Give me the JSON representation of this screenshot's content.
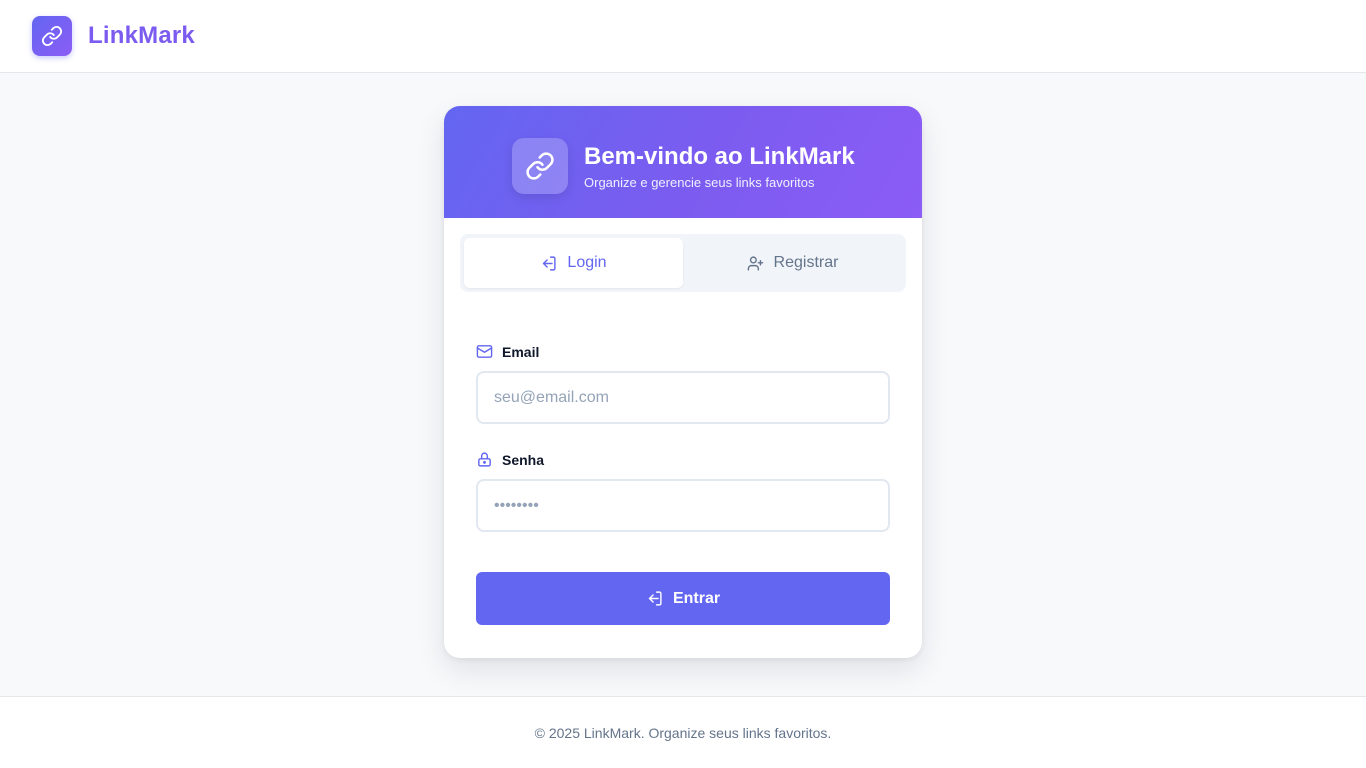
{
  "app": {
    "name": "LinkMark",
    "logo_icon": "link-icon",
    "accent": "#6366f1",
    "accent_secondary": "#8b5cf6"
  },
  "card": {
    "title": "Bem-vindo ao LinkMark",
    "subtitle": "Organize e gerencie seus links favoritos",
    "header_icon": "link-icon"
  },
  "tabs": [
    {
      "label": "Login",
      "icon": "login-icon",
      "active": true
    },
    {
      "label": "Registrar",
      "icon": "user-plus-icon",
      "active": false
    }
  ],
  "form": {
    "email": {
      "label": "Email",
      "icon": "mail-icon",
      "placeholder": "seu@email.com",
      "value": ""
    },
    "password": {
      "label": "Senha",
      "icon": "lock-icon",
      "placeholder": "••••••••",
      "value": ""
    },
    "submit_label": "Entrar",
    "submit_icon": "login-icon"
  },
  "footer": {
    "text": "© 2025 LinkMark. Organize seus links favoritos."
  }
}
